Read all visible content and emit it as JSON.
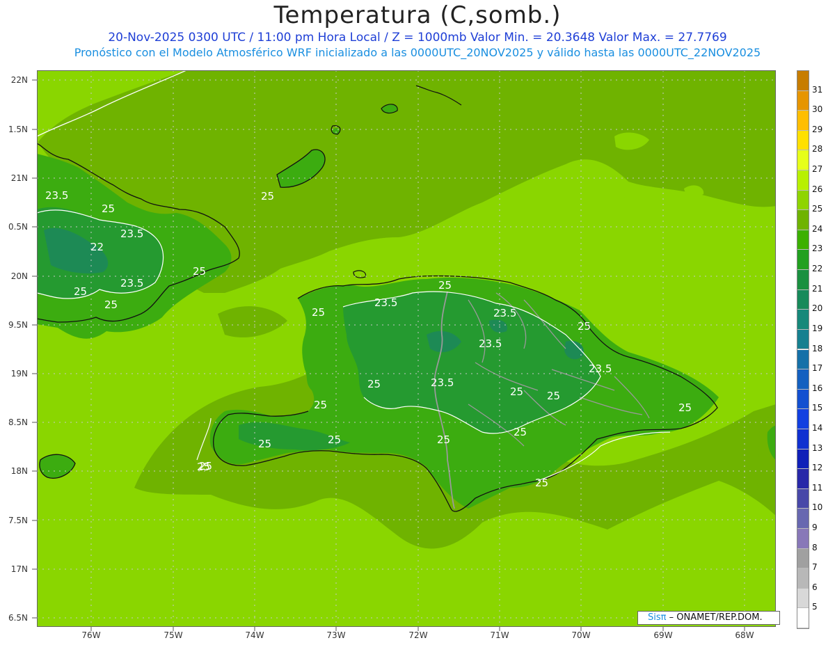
{
  "title": "Temperatura (C,somb.)",
  "subtitle_line1": "20-Nov-2025 0300 UTC / 11:00 pm Hora Local / Z = 1000mb   Valor Min. = 20.3648   Valor Max. = 27.7769",
  "subtitle_line2": "Pronóstico con el Modelo Atmosférico WRF inicializado a las 0000UTC_20NOV2025 y válido hasta las  0000UTC_22NOV2025",
  "y_ticks": [
    "22N",
    "1.5N",
    "21N",
    "0.5N",
    "20N",
    "9.5N",
    "19N",
    "8.5N",
    "18N",
    "7.5N",
    "17N",
    "6.5N"
  ],
  "x_ticks": [
    "76W",
    "75W",
    "74W",
    "73W",
    "72W",
    "71W",
    "70W",
    "69W",
    "68W"
  ],
  "contour_labels": [
    "23.5",
    "25",
    "22",
    "23.5",
    "23.5",
    "25",
    "25",
    "25",
    "25",
    "25",
    "23.5",
    "25",
    "23.5",
    "23.5",
    "25",
    "23.5",
    "25",
    "25",
    "23.5",
    "25",
    "25",
    "25",
    "25",
    "25",
    "25",
    "25",
    "25",
    "25",
    "25"
  ],
  "colorbar": {
    "labels": [
      "31",
      "30",
      "29",
      "28",
      "27",
      "26",
      "25",
      "24",
      "23",
      "22",
      "21",
      "20",
      "19",
      "18",
      "17",
      "16",
      "15",
      "14",
      "13",
      "12",
      "11",
      "10",
      "9",
      "8",
      "7",
      "6",
      "5"
    ],
    "colors": [
      "#c77d00",
      "#e69500",
      "#ffbe00",
      "#ffe000",
      "#e6ff1a",
      "#b8f000",
      "#8fd400",
      "#6fb300",
      "#3cb000",
      "#22a020",
      "#1a9040",
      "#178a5a",
      "#16887a",
      "#168090",
      "#1570a8",
      "#1460c0",
      "#1350d0",
      "#1240e0",
      "#1030d0",
      "#1020b8",
      "#2828a8",
      "#4848a8",
      "#6868b0",
      "#8878b8",
      "#a0a0a0",
      "#b8b8b8",
      "#d8d8d8",
      "#ffffff"
    ]
  },
  "colors": {
    "ocean_light": "#8ad600",
    "ocean_mid": "#6fb300",
    "land_25": "#3cac10",
    "land_235": "#259a30",
    "land_22": "#1d8a55",
    "title_blue": "#1f3fd6",
    "sub_blue": "#1a8fe0"
  },
  "credit": {
    "sis": "Sisπ",
    "org": " – ONAMET/REP.DOM."
  }
}
